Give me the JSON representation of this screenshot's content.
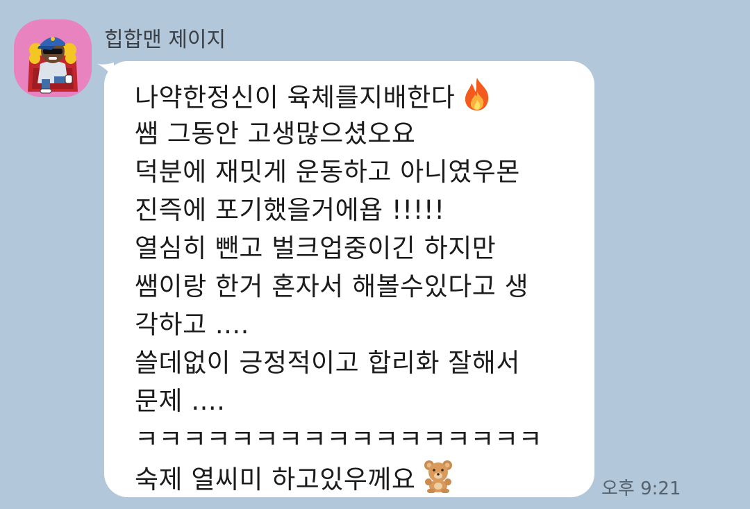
{
  "chat": {
    "sender_name": "힙합맨 제이지",
    "avatar_icon": "hiphop-character-avatar-icon",
    "message_lines": [
      "나약한정신이 육체를지배한다",
      "쌤 그동안 고생많으셨오요",
      "덕분에 재밋게 운동하고 아니였우몬",
      "진즉에 포기했을거에욥 !!!!!",
      "열심히 뺀고 벌크업중이긴 하지만",
      "쌤이랑 한거 혼자서 해볼수있다고 생",
      "각하고 ....",
      "쓸데없이 긍정적이고 합리화 잘해서",
      "문제 ....",
      "ㅋㅋㅋㅋㅋㅋㅋㅋㅋㅋㅋㅋㅋㅋㅋㅋㅋ",
      "숙제 열씨미 하고있우께요"
    ],
    "line1_emoji": "fire-emoji-icon",
    "last_line_emoji": "teddy-bear-emoji-icon",
    "timestamp": "오후 9:21"
  },
  "colors": {
    "background": "#b2c7d9",
    "bubble": "#ffffff",
    "avatar_bg": "#e883bf"
  }
}
